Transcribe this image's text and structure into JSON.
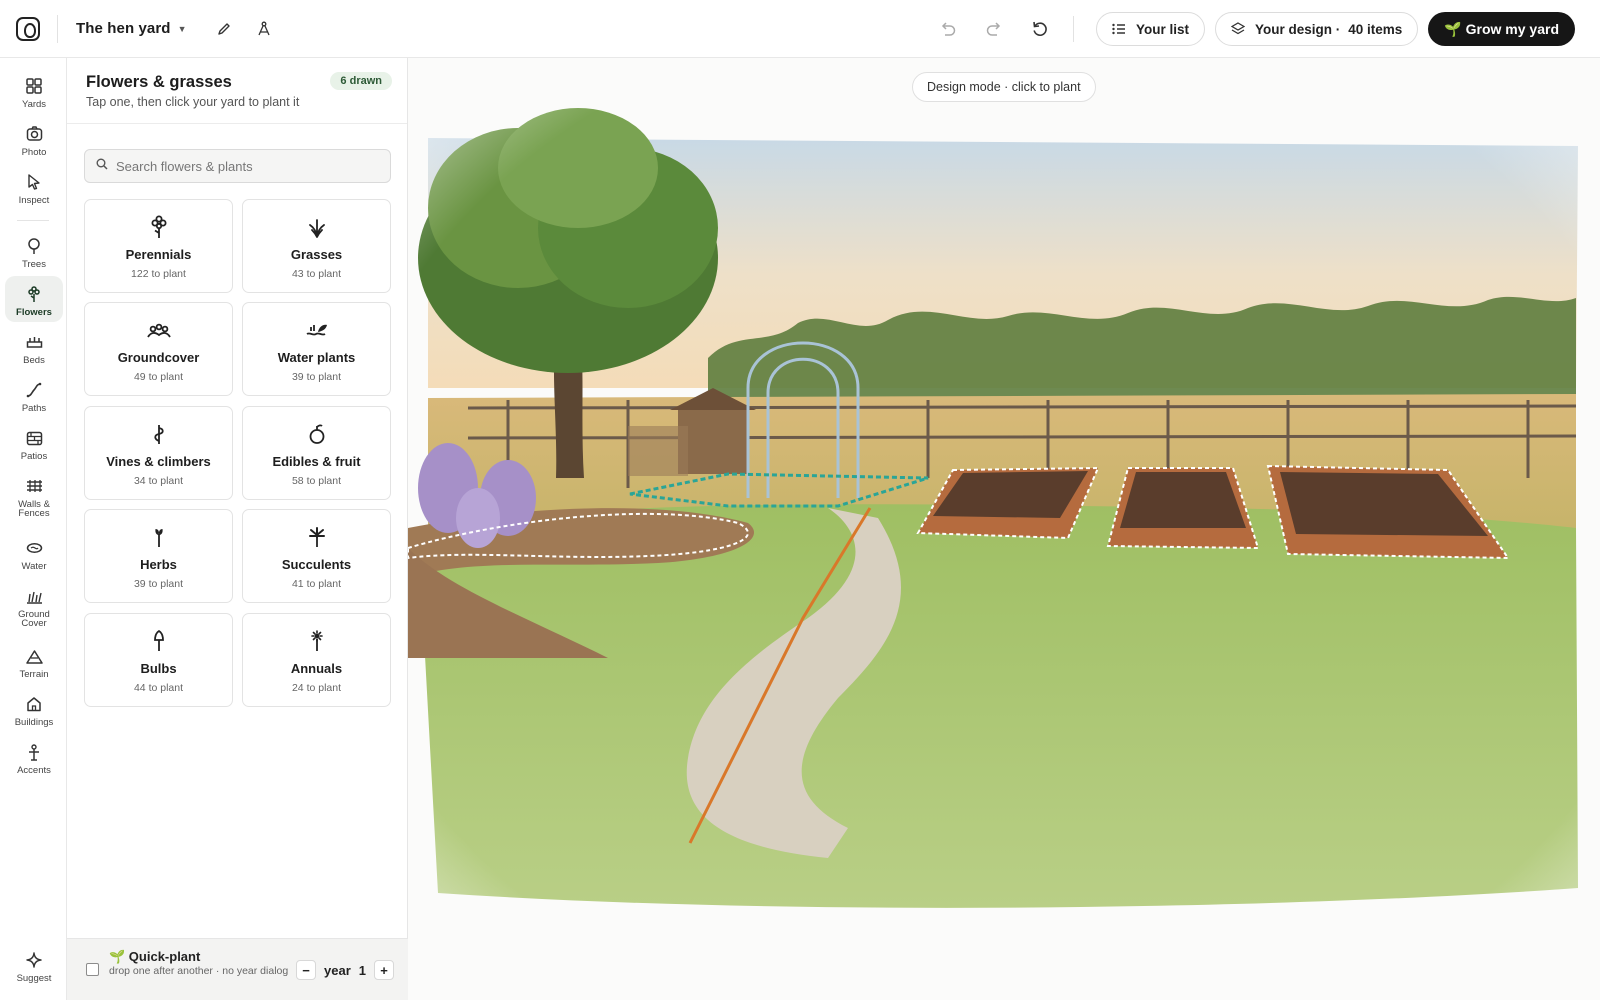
{
  "app": {
    "yard_name": "The hen yard"
  },
  "topbar": {
    "your_list": "Your list",
    "your_design": "Your design ·",
    "design_count": "40 items",
    "grow_button": "🌱 Grow my yard"
  },
  "rail": {
    "items": [
      {
        "label": "Yards",
        "icon": "grid-icon"
      },
      {
        "label": "Photo",
        "icon": "camera-icon"
      },
      {
        "label": "Inspect",
        "icon": "cursor-icon"
      },
      {
        "label": "Trees",
        "icon": "tree-icon"
      },
      {
        "label": "Flowers",
        "icon": "flower-icon",
        "active": true
      },
      {
        "label": "Beds",
        "icon": "bed-icon"
      },
      {
        "label": "Paths",
        "icon": "path-icon"
      },
      {
        "label": "Patios",
        "icon": "patio-icon"
      },
      {
        "label": "Walls & Fences",
        "icon": "fence-icon"
      },
      {
        "label": "Water",
        "icon": "water-icon"
      },
      {
        "label": "Ground Cover",
        "icon": "groundcover-icon"
      },
      {
        "label": "Terrain",
        "icon": "terrain-icon"
      },
      {
        "label": "Buildings",
        "icon": "building-icon"
      },
      {
        "label": "Accents",
        "icon": "accent-icon"
      },
      {
        "label": "Suggest",
        "icon": "sparkle-icon"
      }
    ]
  },
  "panel": {
    "title": "Flowers & grasses",
    "subtitle": "Tap one, then click your yard to plant it",
    "badge": "6 drawn",
    "search_placeholder": "Search flowers & plants",
    "categories": [
      {
        "name": "Perennials",
        "count": "122 to plant",
        "icon": "perennial-icon"
      },
      {
        "name": "Grasses",
        "count": "43 to plant",
        "icon": "grass-icon"
      },
      {
        "name": "Groundcover",
        "count": "49 to plant",
        "icon": "groundcover-icon"
      },
      {
        "name": "Water plants",
        "count": "39 to plant",
        "icon": "water-plant-icon"
      },
      {
        "name": "Vines & climbers",
        "count": "34 to plant",
        "icon": "vine-icon"
      },
      {
        "name": "Edibles & fruit",
        "count": "58 to plant",
        "icon": "fruit-icon"
      },
      {
        "name": "Herbs",
        "count": "39 to plant",
        "icon": "herb-icon"
      },
      {
        "name": "Succulents",
        "count": "41 to plant",
        "icon": "succulent-icon"
      },
      {
        "name": "Bulbs",
        "count": "44 to plant",
        "icon": "bulb-icon"
      },
      {
        "name": "Annuals",
        "count": "24 to plant",
        "icon": "annual-icon"
      }
    ]
  },
  "quick_plant": {
    "title": "🌱 Quick-plant",
    "subtitle": "drop one after another · no year dialog",
    "year_label": "year",
    "year_value": "1",
    "minus": "−",
    "plus": "+"
  },
  "canvas": {
    "mode_chip": "Design mode · click to plant"
  },
  "colors": {
    "accent_dark": "#161616",
    "badge_green": "#e8f2e8",
    "path_line": "#d9782a",
    "teal_outline": "#2aa597",
    "grass": "#8db35a"
  }
}
